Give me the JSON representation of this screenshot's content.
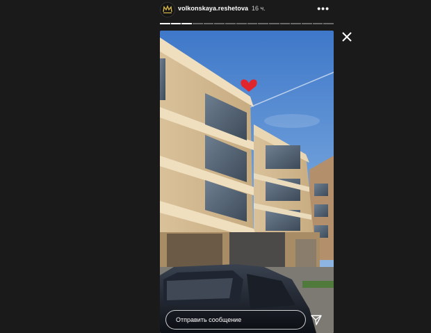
{
  "header": {
    "username": "volkonskaya.reshetova",
    "time": "16 ч."
  },
  "progress": {
    "segments_total": 16,
    "segments_done": 3
  },
  "story": {
    "sticker": "heart-sticker"
  },
  "reply": {
    "placeholder": "Отправить сообщение"
  },
  "icons": {
    "more": "more-dots-icon",
    "close": "close-icon",
    "send": "send-icon"
  }
}
